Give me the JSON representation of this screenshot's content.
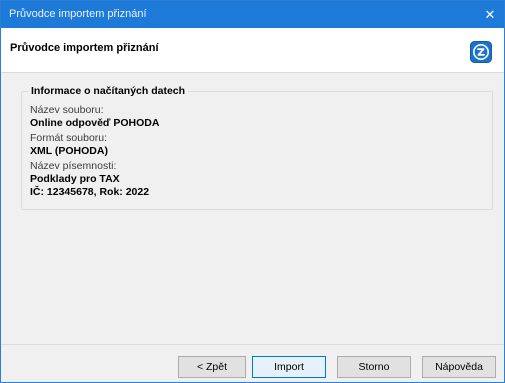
{
  "window": {
    "title": "Průvodce importem přiznání",
    "close_glyph": "✕"
  },
  "header": {
    "heading": "Průvodce importem přiznání",
    "logo_icon": "pohoda-logo-icon"
  },
  "info": {
    "legend": "Informace o načítaných datech",
    "file_name_label": "Název souboru:",
    "file_name_value": "Online odpověď POHODA",
    "file_format_label": "Formát souboru:",
    "file_format_value": "XML (POHODA)",
    "document_name_label": "Název písemnosti:",
    "document_name_value": "Podklady pro TAX",
    "id_year_value": "IČ: 12345678, Rok: 2022"
  },
  "buttons": {
    "back": "< Zpět",
    "import": "Import",
    "cancel": "Storno",
    "help": "Nápověda"
  },
  "colors": {
    "titlebar": "#1e7ad9",
    "logo_bg": "#1a73c9"
  }
}
